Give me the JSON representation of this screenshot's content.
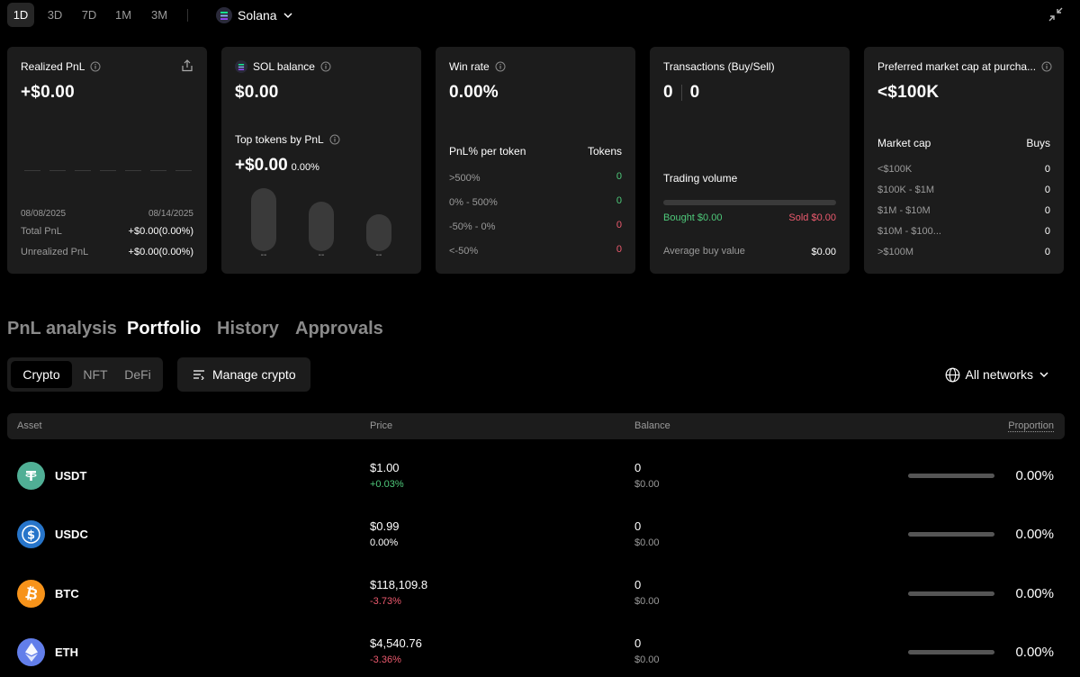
{
  "periods": [
    "1D",
    "3D",
    "7D",
    "1M",
    "3M"
  ],
  "network": {
    "label": "Solana"
  },
  "cards": {
    "realized": {
      "title": "Realized PnL",
      "value": "+$0.00",
      "date_start": "08/08/2025",
      "date_end": "08/14/2025",
      "total_label": "Total PnL",
      "total_value": "+$0.00(0.00%)",
      "unrealized_label": "Unrealized PnL",
      "unrealized_value": "+$0.00(0.00%)"
    },
    "sol": {
      "title": "SOL balance",
      "value": "$0.00",
      "top_title": "Top tokens by PnL",
      "top_value": "+$0.00",
      "top_pct": "0.00%",
      "pill_labels": [
        "--",
        "--",
        "--"
      ]
    },
    "winrate": {
      "title": "Win rate",
      "value": "0.00%",
      "col_left": "PnL% per token",
      "col_right": "Tokens",
      "rows": [
        {
          "label": ">500%",
          "value": "0"
        },
        {
          "label": "0% - 500%",
          "value": "0"
        },
        {
          "label": "-50% - 0%",
          "value": "0"
        },
        {
          "label": "<-50%",
          "value": "0"
        }
      ]
    },
    "tx": {
      "title": "Transactions (Buy/Sell)",
      "buys": "0",
      "sells": "0",
      "volume_label": "Trading volume",
      "bought": "Bought $0.00",
      "sold": "Sold $0.00",
      "avg_label": "Average buy value",
      "avg_value": "$0.00"
    },
    "mcap": {
      "title": "Preferred market cap at purcha...",
      "value": "<$100K",
      "col_left": "Market cap",
      "col_right": "Buys",
      "rows": [
        {
          "label": "<$100K",
          "value": "0"
        },
        {
          "label": "$100K - $1M",
          "value": "0"
        },
        {
          "label": "$1M - $10M",
          "value": "0"
        },
        {
          "label": "$10M - $100...",
          "value": "0"
        },
        {
          "label": ">$100M",
          "value": "0"
        }
      ]
    }
  },
  "main_tabs": [
    "PnL analysis",
    "Portfolio",
    "History",
    "Approvals"
  ],
  "segments": [
    "Crypto",
    "NFT",
    "DeFi"
  ],
  "manage_label": "Manage crypto",
  "all_networks_label": "All networks",
  "table": {
    "headers": {
      "asset": "Asset",
      "price": "Price",
      "balance": "Balance",
      "proportion": "Proportion"
    },
    "rows": [
      {
        "name": "USDT",
        "price": "$1.00",
        "change": "+0.03%",
        "balance": "0",
        "balance_usd": "$0.00",
        "proportion": "0.00%"
      },
      {
        "name": "USDC",
        "price": "$0.99",
        "change": "0.00%",
        "balance": "0",
        "balance_usd": "$0.00",
        "proportion": "0.00%"
      },
      {
        "name": "BTC",
        "price": "$118,109.8",
        "change": "-3.73%",
        "balance": "0",
        "balance_usd": "$0.00",
        "proportion": "0.00%"
      },
      {
        "name": "ETH",
        "price": "$4,540.76",
        "change": "-3.36%",
        "balance": "0",
        "balance_usd": "$0.00",
        "proportion": "0.00%"
      }
    ]
  },
  "icons": {
    "usdt": "tether-icon",
    "usdc": "usdc-icon",
    "btc": "bitcoin-icon",
    "eth": "ethereum-icon",
    "info": "info-icon",
    "share": "share-icon",
    "globe": "globe-icon",
    "collapse": "collapse-icon"
  },
  "colors": {
    "green": "#4ec97a",
    "red": "#ec5a6e",
    "usdt": "#50af95",
    "usdc": "#2775ca",
    "btc": "#f7931a",
    "eth": "#627eea"
  }
}
